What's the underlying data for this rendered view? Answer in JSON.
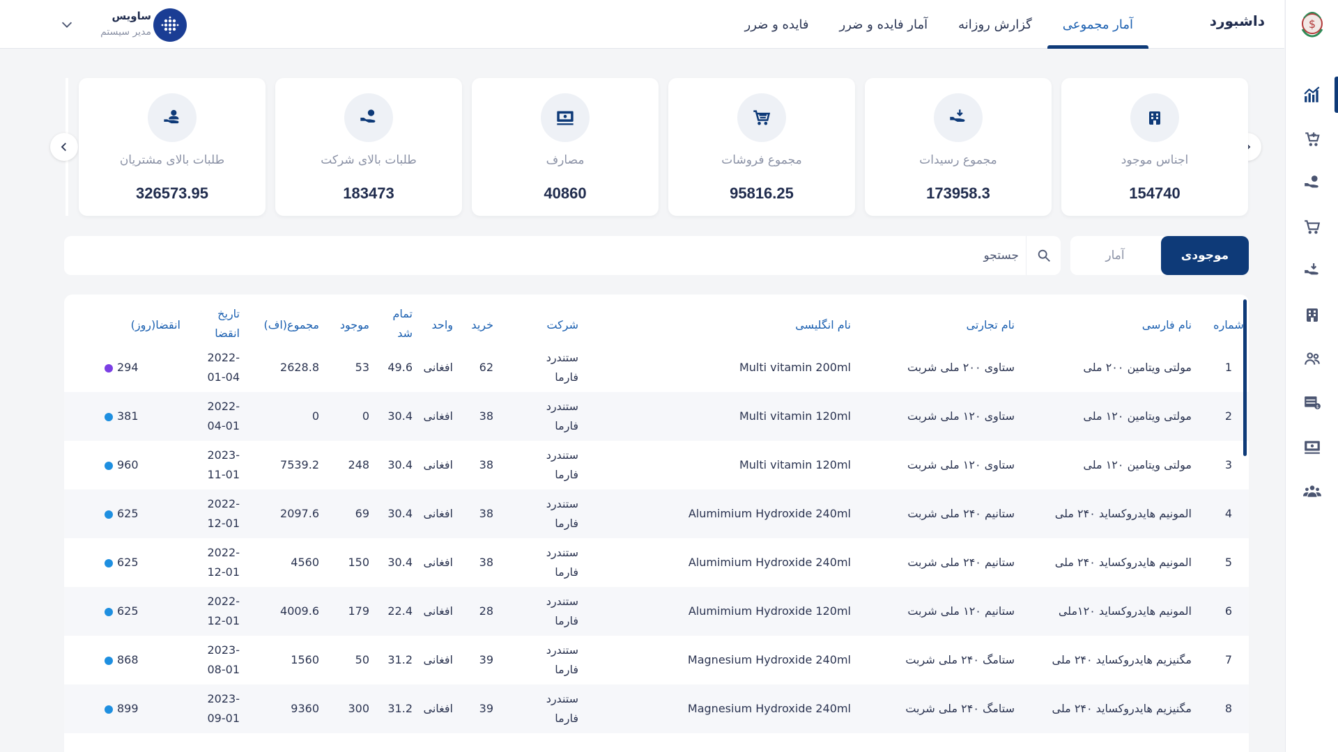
{
  "header": {
    "title": "داشبورد",
    "tabs": [
      {
        "label": "آمار مجموعی",
        "active": true
      },
      {
        "label": "گزارش روزانه",
        "active": false
      },
      {
        "label": "آمار فایده و ضرر",
        "active": false
      },
      {
        "label": "فایده و ضرر",
        "active": false
      }
    ],
    "user": {
      "name": "ساویس",
      "role": "مدیر سیستم"
    }
  },
  "sidebar": {
    "icons": [
      "chart-icon",
      "cart-plus-icon",
      "hand-coin-icon",
      "cart-icon",
      "hand-receive-icon",
      "building-icon",
      "users-icon",
      "money-table-icon",
      "cash-icon",
      "group-icon"
    ]
  },
  "cards": [
    {
      "label": "اجناس موجود",
      "value": "154740",
      "icon": "building-icon"
    },
    {
      "label": "مجموع رسیدات",
      "value": "173958.3",
      "icon": "hand-receive-icon"
    },
    {
      "label": "مجموع فروشات",
      "value": "95816.25",
      "icon": "cart-icon"
    },
    {
      "label": "مصارف",
      "value": "40860",
      "icon": "cash-icon"
    },
    {
      "label": "طلبات بالای شرکت",
      "value": "183473",
      "icon": "hand-coin-icon"
    },
    {
      "label": "طلبات بالای مشتریان",
      "value": "326573.95",
      "icon": "user-hand-icon"
    }
  ],
  "toggle": {
    "active": "موجودی",
    "inactive": "آمار"
  },
  "search": {
    "placeholder": "جستجو"
  },
  "table": {
    "headers": {
      "num": "شماره",
      "fa_name": "نام فارسی",
      "trade_name": "نام تجارتی",
      "en_name": "نام انگلیسی",
      "company": "شرکت",
      "buy": "خرید",
      "unit": "واحد",
      "cost": "تمام شد",
      "stock": "موجود",
      "total": "مجموع(اف)",
      "exp_date": "تاریخ انقضا",
      "exp_days": "انقضا(روز)"
    },
    "rows": [
      {
        "num": "1",
        "fa_name": "مولتی ویتامین ۲۰۰ ملی",
        "trade_name": "ستاوی ۲۰۰ ملی شربت",
        "en_name": "Multi vitamin 200ml",
        "company": "ستندرد فارما",
        "buy": "62",
        "unit": "افغانی",
        "cost": "49.6",
        "stock": "53",
        "total": "2628.8",
        "exp_date": "2022-01-04",
        "exp_days": "294",
        "dot": "#7b3fe4"
      },
      {
        "num": "2",
        "fa_name": "مولتی ویتامین ۱۲۰ ملی",
        "trade_name": "ستاوی ۱۲۰ ملی شربت",
        "en_name": "Multi vitamin 120ml",
        "company": "ستندرد فارما",
        "buy": "38",
        "unit": "افغانی",
        "cost": "30.4",
        "stock": "0",
        "total": "0",
        "exp_date": "2022-04-01",
        "exp_days": "381",
        "dot": "#1e8fe0"
      },
      {
        "num": "3",
        "fa_name": "مولتی ویتامین ۱۲۰ ملی",
        "trade_name": "ستاوی ۱۲۰ ملی شربت",
        "en_name": "Multi vitamin 120ml",
        "company": "ستندرد فارما",
        "buy": "38",
        "unit": "افغانی",
        "cost": "30.4",
        "stock": "248",
        "total": "7539.2",
        "exp_date": "2023-11-01",
        "exp_days": "960",
        "dot": "#1e8fe0"
      },
      {
        "num": "4",
        "fa_name": "المونیم هایدروکساید ۲۴۰ ملی",
        "trade_name": "ستانیم ۲۴۰ ملی شربت",
        "en_name": "Alumimium Hydroxide 240ml",
        "company": "ستندرد فارما",
        "buy": "38",
        "unit": "افغانی",
        "cost": "30.4",
        "stock": "69",
        "total": "2097.6",
        "exp_date": "2022-12-01",
        "exp_days": "625",
        "dot": "#1e8fe0"
      },
      {
        "num": "5",
        "fa_name": "المونیم هایدروکساید ۲۴۰ ملی",
        "trade_name": "ستانیم ۲۴۰ ملی شربت",
        "en_name": "Alumimium Hydroxide 240ml",
        "company": "ستندرد فارما",
        "buy": "38",
        "unit": "افغانی",
        "cost": "30.4",
        "stock": "150",
        "total": "4560",
        "exp_date": "2022-12-01",
        "exp_days": "625",
        "dot": "#1e8fe0"
      },
      {
        "num": "6",
        "fa_name": "المونیم هایدروکساید ۱۲۰ملی",
        "trade_name": "ستانیم ۱۲۰ ملی شربت",
        "en_name": "Alumimium Hydroxide 120ml",
        "company": "ستندرد فارما",
        "buy": "28",
        "unit": "افغانی",
        "cost": "22.4",
        "stock": "179",
        "total": "4009.6",
        "exp_date": "2022-12-01",
        "exp_days": "625",
        "dot": "#1e8fe0"
      },
      {
        "num": "7",
        "fa_name": "مگنیزیم هایدروکساید ۲۴۰ ملی",
        "trade_name": "ستامگ ۲۴۰ ملی شربت",
        "en_name": "Magnesium Hydroxide 240ml",
        "company": "ستندرد فارما",
        "buy": "39",
        "unit": "افغانی",
        "cost": "31.2",
        "stock": "50",
        "total": "1560",
        "exp_date": "2023-08-01",
        "exp_days": "868",
        "dot": "#1e8fe0"
      },
      {
        "num": "8",
        "fa_name": "مگنیزیم هایدروکساید ۲۴۰ ملی",
        "trade_name": "ستامگ ۲۴۰ ملی شربت",
        "en_name": "Magnesium Hydroxide 240ml",
        "company": "ستندرد فارما",
        "buy": "39",
        "unit": "افغانی",
        "cost": "31.2",
        "stock": "300",
        "total": "9360",
        "exp_date": "2023-09-01",
        "exp_days": "899",
        "dot": "#1e8fe0"
      }
    ]
  },
  "colors": {
    "primary": "#0e3a78",
    "accent": "#1a5fb0",
    "muted": "#8a91a5",
    "background": "#f4f5f7"
  }
}
